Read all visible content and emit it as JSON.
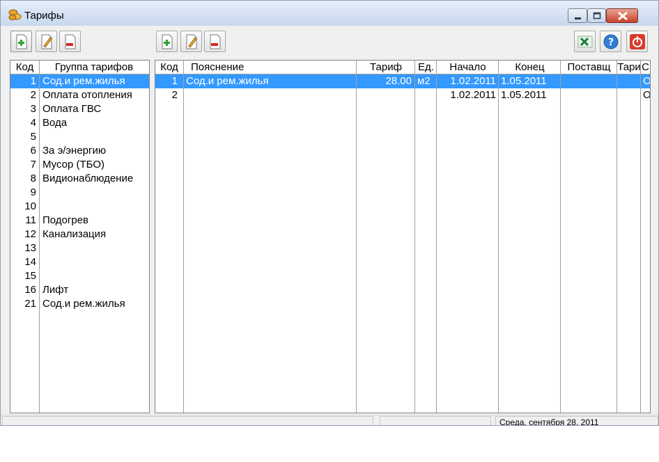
{
  "window": {
    "title": "Тарифы"
  },
  "groups": {
    "headers": {
      "code": "Код",
      "name": "Группа тарифов"
    },
    "selected_index": 0,
    "rows": [
      {
        "code": "1",
        "name": "Сод.и рем.жилья"
      },
      {
        "code": "2",
        "name": "Оплата отопления"
      },
      {
        "code": "3",
        "name": "Оплата ГВС"
      },
      {
        "code": "4",
        "name": "Вода"
      },
      {
        "code": "5",
        "name": ""
      },
      {
        "code": "6",
        "name": "За э/энергию"
      },
      {
        "code": "7",
        "name": "Мусор (ТБО)"
      },
      {
        "code": "8",
        "name": "Видионаблюдение"
      },
      {
        "code": "9",
        "name": ""
      },
      {
        "code": "10",
        "name": ""
      },
      {
        "code": "11",
        "name": "Подогрев"
      },
      {
        "code": "12",
        "name": "Канализация"
      },
      {
        "code": "13",
        "name": ""
      },
      {
        "code": "14",
        "name": ""
      },
      {
        "code": "15",
        "name": ""
      },
      {
        "code": "16",
        "name": "Лифт"
      },
      {
        "code": "21",
        "name": "Сод.и рем.жилья"
      }
    ]
  },
  "tariffs": {
    "headers": {
      "code": "Код",
      "desc": "Пояснение",
      "tariff": "Тариф",
      "unit": "Ед.",
      "start": "Начало",
      "end": "Конец",
      "supplier": "Поставщ",
      "tar2": "Тари",
      "extra": "С"
    },
    "selected_index": 0,
    "rows": [
      {
        "code": "1",
        "desc": "Сод.и рем.жилья",
        "tariff": "28.00",
        "unit": "м2",
        "start": "1.02.2011",
        "end": "1.05.2011",
        "supplier": "",
        "tar2": "",
        "extra": "О"
      },
      {
        "code": "2",
        "desc": "",
        "tariff": "",
        "unit": "",
        "start": "1.02.2011",
        "end": "1.05.2011",
        "supplier": "",
        "tar2": "",
        "extra": "О"
      }
    ]
  },
  "status": {
    "date": "Среда, сентября 28, 2011"
  },
  "icons": {
    "app": "coins-icon",
    "add": "add-document-icon",
    "edit": "edit-pencil-icon",
    "delete": "delete-document-icon",
    "excel": "excel-icon",
    "help": "help-icon",
    "exit": "power-icon"
  },
  "colors": {
    "selection": "#3399ff",
    "titlebar": "#c7d8ee",
    "close_button": "#c7432a"
  }
}
